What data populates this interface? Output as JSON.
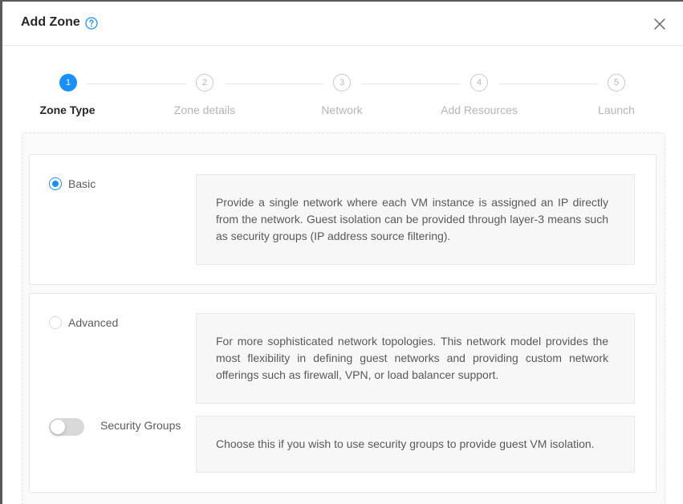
{
  "modal": {
    "title": "Add Zone",
    "help_icon": "question-circle-icon",
    "close_icon": "close-icon"
  },
  "steps": [
    {
      "number": "1",
      "label": "Zone Type",
      "status": "active"
    },
    {
      "number": "2",
      "label": "Zone details",
      "status": "wait"
    },
    {
      "number": "3",
      "label": "Network",
      "status": "wait"
    },
    {
      "number": "4",
      "label": "Add Resources",
      "status": "wait"
    },
    {
      "number": "5",
      "label": "Launch",
      "status": "wait"
    }
  ],
  "options": {
    "basic": {
      "label": "Basic",
      "checked": true,
      "description": "Provide a single network where each VM instance is assigned an IP directly from the network. Guest isolation can be provided through layer-3 means such as security groups (IP address source filtering)."
    },
    "advanced": {
      "label": "Advanced",
      "checked": false,
      "description": "For more sophisticated network topologies. This network model provides the most flexibility in defining guest networks and providing custom network offerings such as firewall, VPN, or load balancer support."
    },
    "security_groups": {
      "label": "Security Groups",
      "enabled": false,
      "description": "Choose this if you wish to use security groups to provide guest VM isolation."
    }
  },
  "colors": {
    "primary": "#1890ff",
    "border": "#e8e8e8",
    "desc_bg": "#f7f7f7"
  }
}
